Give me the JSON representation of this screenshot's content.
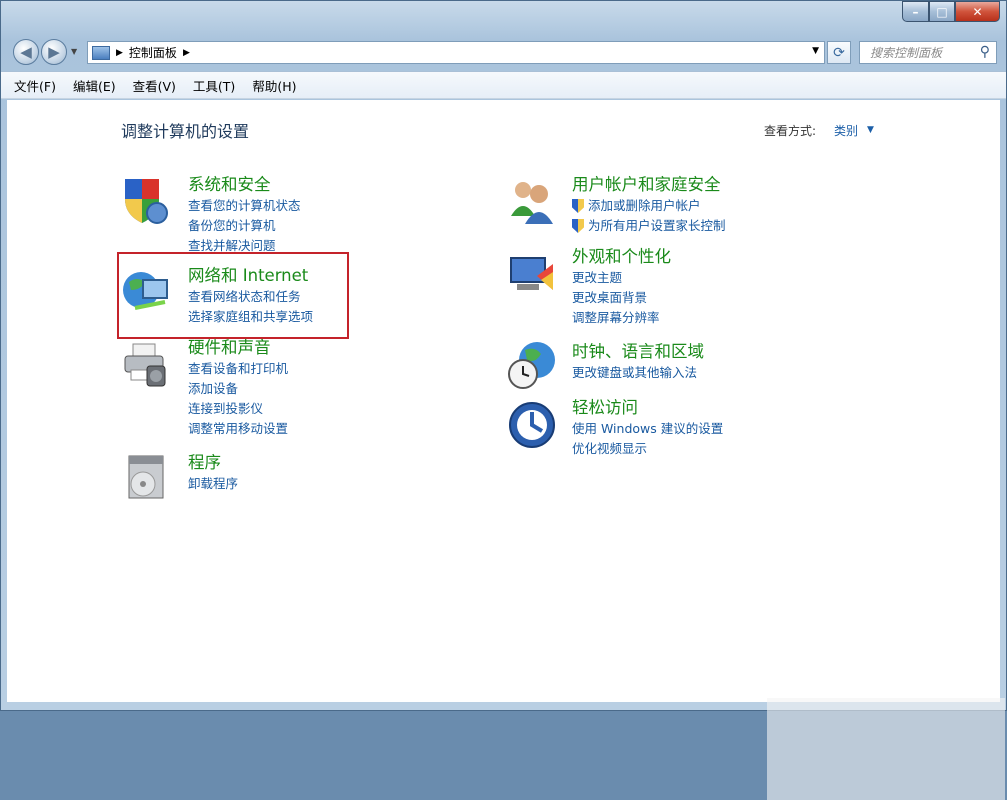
{
  "window": {
    "caption_buttons": {
      "minimize": "–",
      "maximize": "□",
      "close": "✕"
    }
  },
  "address": {
    "path": "控制面板",
    "search_placeholder": "搜索控制面板"
  },
  "menu": [
    "文件(F)",
    "编辑(E)",
    "查看(V)",
    "工具(T)",
    "帮助(H)"
  ],
  "page": {
    "title": "调整计算机的设置",
    "view_by_label": "查看方式:",
    "view_by_value": "类别"
  },
  "categories_left": [
    {
      "icon": "security-shield-icon",
      "title": "系统和安全",
      "links": [
        "查看您的计算机状态",
        "备份您的计算机",
        "查找并解决问题"
      ]
    },
    {
      "icon": "network-globe-icon",
      "title": "网络和 Internet",
      "links": [
        "查看网络状态和任务",
        "选择家庭组和共享选项"
      ]
    },
    {
      "icon": "printer-icon",
      "title": "硬件和声音",
      "links": [
        "查看设备和打印机",
        "添加设备",
        "连接到投影仪",
        "调整常用移动设置"
      ]
    },
    {
      "icon": "programs-disc-icon",
      "title": "程序",
      "links": [
        "卸载程序"
      ]
    }
  ],
  "categories_right": [
    {
      "icon": "users-icon",
      "title": "用户帐户和家庭安全",
      "links": [
        "添加或删除用户帐户",
        "为所有用户设置家长控制"
      ],
      "shield_links": true
    },
    {
      "icon": "appearance-display-icon",
      "title": "外观和个性化",
      "links": [
        "更改主题",
        "更改桌面背景",
        "调整屏幕分辨率"
      ]
    },
    {
      "icon": "clock-globe-icon",
      "title": "时钟、语言和区域",
      "links": [
        "更改键盘或其他输入法"
      ]
    },
    {
      "icon": "ease-of-access-icon",
      "title": "轻松访问",
      "links": [
        "使用 Windows 建议的设置",
        "优化视频显示"
      ]
    }
  ]
}
